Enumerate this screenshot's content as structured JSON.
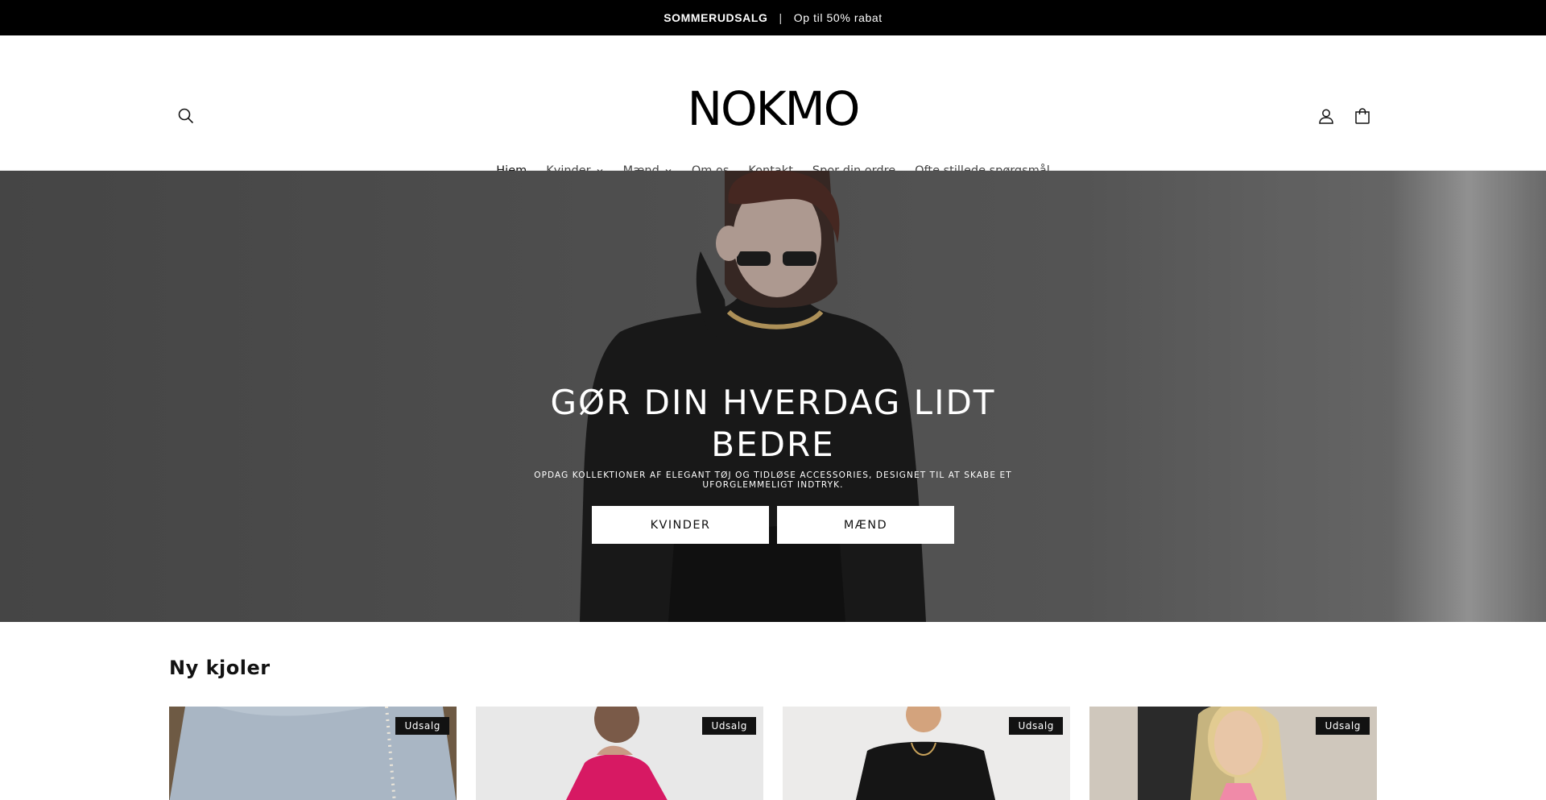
{
  "announcement": {
    "bold": "SOMMERUDSALG",
    "separator": "|",
    "text": "Op til 50% rabat"
  },
  "header": {
    "logo": "NOKMO",
    "icons": {
      "search": "search-icon",
      "account": "user-icon",
      "cart": "cart-icon"
    }
  },
  "nav": {
    "items": [
      {
        "label": "Hjem",
        "active": true
      },
      {
        "label": "Kvinder",
        "dropdown": true
      },
      {
        "label": "Mænd",
        "dropdown": true
      },
      {
        "label": "Om os"
      },
      {
        "label": "Kontakt"
      },
      {
        "label": "Spor din ordre"
      },
      {
        "label": "Ofte stillede spørgsmål"
      }
    ]
  },
  "hero": {
    "title_line1": "GØR DIN HVERDAG LIDT",
    "title_line2": "BEDRE",
    "subtitle": "OPDAG KOLLEKTIONER AF ELEGANT TØJ OG TIDLØSE ACCESSORIES, DESIGNET TIL AT SKABE ET UFORGLEMMELIGT INDTRYK.",
    "buttons": [
      "KVINDER",
      "MÆND"
    ]
  },
  "section": {
    "title": "Ny kjoler"
  },
  "products": [
    {
      "badge": "Udsalg"
    },
    {
      "badge": "Udsalg"
    },
    {
      "badge": "Udsalg"
    },
    {
      "badge": "Udsalg"
    }
  ],
  "colors": {
    "announcement_bg": "#000000",
    "badge_bg": "#121212",
    "hero_bg": "#555555"
  }
}
